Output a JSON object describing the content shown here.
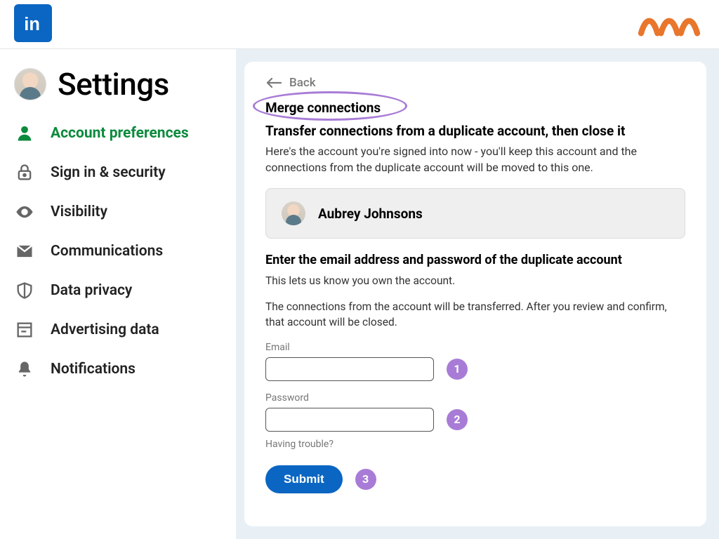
{
  "header": {
    "linkedin_alt": "LinkedIn"
  },
  "sidebar": {
    "title": "Settings",
    "items": [
      {
        "label": "Account preferences"
      },
      {
        "label": "Sign in & security"
      },
      {
        "label": "Visibility"
      },
      {
        "label": "Communications"
      },
      {
        "label": "Data privacy"
      },
      {
        "label": "Advertising data"
      },
      {
        "label": "Notifications"
      }
    ]
  },
  "main": {
    "back_label": "Back",
    "section_title": "Merge connections",
    "subheading": "Transfer connections from a duplicate account, then close it",
    "intro_text": "Here's the account you're signed into now - you'll keep this account and the connections from the duplicate account will be moved to this one.",
    "current_account_name": "Aubrey Johnsons",
    "form_heading": "Enter the email address and password of the duplicate account",
    "form_sub1": "This lets us know you own the account.",
    "form_sub2": "The connections from the account will be transferred. After you review and confirm, that account will be closed.",
    "email_label": "Email",
    "email_value": "",
    "password_label": "Password",
    "password_value": "",
    "trouble_text": "Having trouble?",
    "submit_label": "Submit"
  },
  "annotations": {
    "step1": "1",
    "step2": "2",
    "step3": "3"
  }
}
